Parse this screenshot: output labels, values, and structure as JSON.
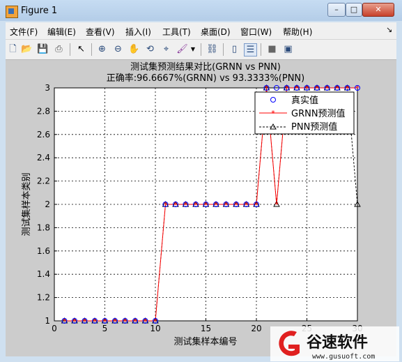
{
  "window": {
    "title": "Figure 1",
    "controls": {
      "minimize": "–",
      "maximize": "□",
      "close": "✕"
    }
  },
  "menubar": {
    "items": [
      "文件(F)",
      "编辑(E)",
      "查看(V)",
      "插入(I)",
      "工具(T)",
      "桌面(D)",
      "窗口(W)",
      "帮助(H)"
    ]
  },
  "toolbar": {
    "icons": [
      "new-figure-icon",
      "open-file-icon",
      "save-icon",
      "print-icon",
      "pointer-icon",
      "zoom-in-icon",
      "zoom-out-icon",
      "pan-icon",
      "rotate-3d-icon",
      "data-cursor-icon",
      "brush-icon",
      "link-plot-icon",
      "colorbar-icon",
      "legend-icon",
      "hide-plot-tools-icon",
      "show-plot-tools-icon"
    ]
  },
  "chart_data": {
    "type": "line",
    "title": "测试集预测结果对比(GRNN vs PNN)",
    "subtitle": "正确率:96.6667%(GRNN) vs 93.3333%(PNN)",
    "xlabel": "测试集样本编号",
    "ylabel": "测试集样本类别",
    "xlim": [
      0,
      30
    ],
    "ylim": [
      1,
      3
    ],
    "xticks": [
      "0",
      "5",
      "10",
      "15",
      "20",
      "25",
      "30"
    ],
    "yticks": [
      "1",
      "1.2",
      "1.4",
      "1.6",
      "1.8",
      "2",
      "2.2",
      "2.4",
      "2.6",
      "2.8",
      "3"
    ],
    "grid": true,
    "legend_position": "top-right",
    "x": [
      1,
      2,
      3,
      4,
      5,
      6,
      7,
      8,
      9,
      10,
      11,
      12,
      13,
      14,
      15,
      16,
      17,
      18,
      19,
      20,
      21,
      22,
      23,
      24,
      25,
      26,
      27,
      28,
      29,
      30
    ],
    "series": [
      {
        "name": "真实值",
        "style": "blue circle markers",
        "color": "#0000ff",
        "values": [
          1,
          1,
          1,
          1,
          1,
          1,
          1,
          1,
          1,
          1,
          2,
          2,
          2,
          2,
          2,
          2,
          2,
          2,
          2,
          2,
          3,
          3,
          3,
          3,
          3,
          3,
          3,
          3,
          3,
          3
        ]
      },
      {
        "name": "GRNN预测值",
        "style": "red solid line with * markers",
        "color": "#ff0000",
        "values": [
          1,
          1,
          1,
          1,
          1,
          1,
          1,
          1,
          1,
          1,
          2,
          2,
          2,
          2,
          2,
          2,
          2,
          2,
          2,
          2,
          3,
          2,
          3,
          3,
          3,
          3,
          3,
          3,
          3,
          3
        ]
      },
      {
        "name": "PNN预测值",
        "style": "black dashed line with triangle markers",
        "color": "#000000",
        "values": [
          1,
          1,
          1,
          1,
          1,
          1,
          1,
          1,
          1,
          1,
          2,
          2,
          2,
          2,
          2,
          2,
          2,
          2,
          2,
          2,
          3,
          2,
          3,
          3,
          3,
          3,
          3,
          3,
          3,
          2
        ]
      }
    ]
  },
  "watermark": {
    "brand_cn": "谷速软件",
    "url": "www.gusuoft.com"
  }
}
